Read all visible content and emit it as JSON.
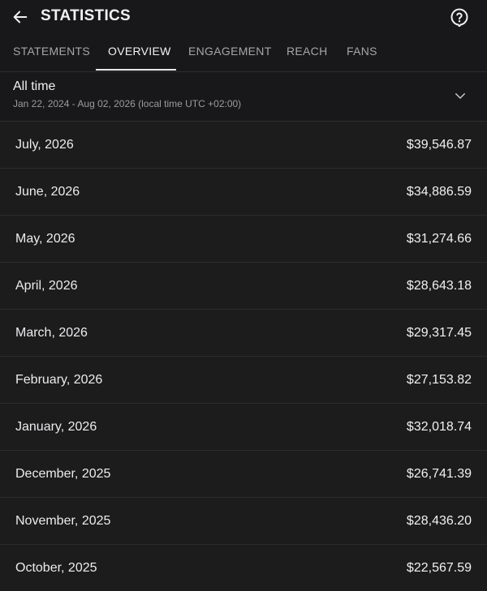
{
  "header": {
    "title": "STATISTICS",
    "back_icon": "arrow-left-icon",
    "help_icon": "help-circle-icon"
  },
  "tabs": [
    {
      "label": "STATEMENTS",
      "active": false
    },
    {
      "label": "OVERVIEW",
      "active": true
    },
    {
      "label": "ENGAGEMENT",
      "active": false
    },
    {
      "label": "REACH",
      "active": false
    },
    {
      "label": "FANS",
      "active": false
    }
  ],
  "period": {
    "title": "All time",
    "range": "Jan 22, 2024 - Aug 02, 2026 (local time UTC +02:00)",
    "icon": "chevron-down-icon"
  },
  "months": [
    {
      "label": "July, 2026",
      "amount": "$39,546.87"
    },
    {
      "label": "June, 2026",
      "amount": "$34,886.59"
    },
    {
      "label": "May, 2026",
      "amount": "$31,274.66"
    },
    {
      "label": "April, 2026",
      "amount": "$28,643.18"
    },
    {
      "label": "March, 2026",
      "amount": "$29,317.45"
    },
    {
      "label": "February, 2026",
      "amount": "$27,153.82"
    },
    {
      "label": "January, 2026",
      "amount": "$32,018.74"
    },
    {
      "label": "December, 2025",
      "amount": "$26,741.39"
    },
    {
      "label": "November, 2025",
      "amount": "$28,436.20"
    },
    {
      "label": "October, 2025",
      "amount": "$22,567.59"
    }
  ],
  "colors": {
    "background": "#1c1c1d",
    "text": "#f1f1f2",
    "muted": "#9c9ca0",
    "divider": "#2c2c2e"
  }
}
